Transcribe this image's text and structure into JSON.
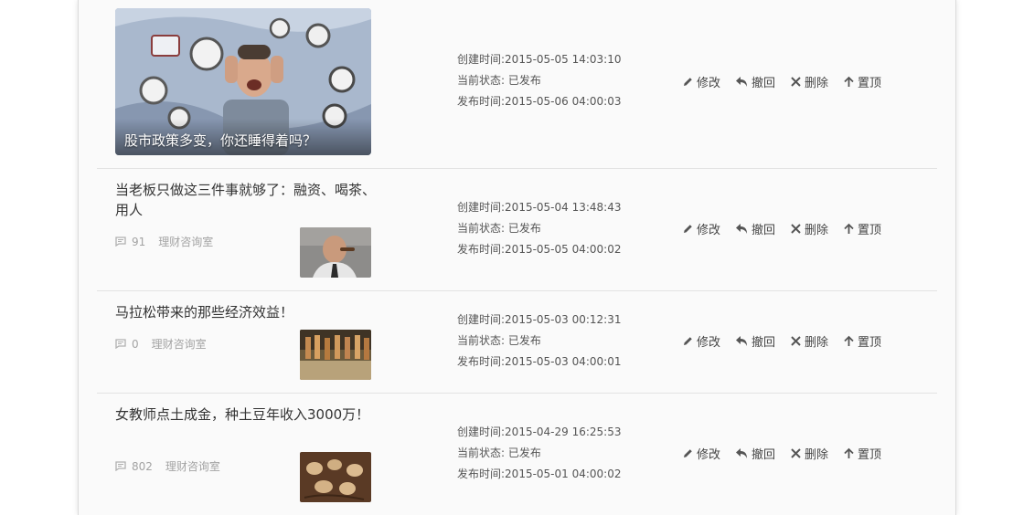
{
  "labels": {
    "created_prefix": "创建时间:",
    "status_prefix": "当前状态: ",
    "published_prefix": "发布时间:"
  },
  "actions": {
    "edit": "修改",
    "withdraw": "撤回",
    "delete": "删除",
    "pin": "置顶"
  },
  "articles": [
    {
      "title": "股市政策多变，你还睡得着吗？",
      "created": "2015-05-05 14:03:10",
      "status": "已发布",
      "published": "2015-05-06 04:00:03"
    },
    {
      "title": "当老板只做这三件事就够了：融资、喝茶、用人",
      "comments": "91",
      "column": "理财咨询室",
      "created": "2015-05-04 13:48:43",
      "status": "已发布",
      "published": "2015-05-05 04:00:02"
    },
    {
      "title": "马拉松带来的那些经济效益！",
      "comments": "0",
      "column": "理财咨询室",
      "created": "2015-05-03 00:12:31",
      "status": "已发布",
      "published": "2015-05-03 04:00:01"
    },
    {
      "title": "女教师点土成金，种土豆年收入3000万！",
      "comments": "802",
      "column": "理财咨询室",
      "created": "2015-04-29 16:25:53",
      "status": "已发布",
      "published": "2015-05-01 04:00:02"
    }
  ],
  "icons": {
    "comment": "comment-icon",
    "edit": "pencil-icon",
    "withdraw": "undo-icon",
    "delete": "close-icon",
    "pin": "arrow-up-icon"
  }
}
